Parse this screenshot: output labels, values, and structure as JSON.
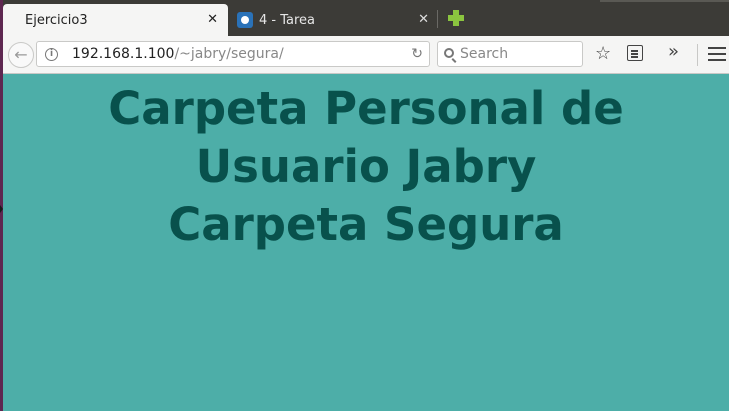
{
  "browser": {
    "tabs": [
      {
        "title": "Ejercicio3",
        "active": true
      },
      {
        "title": "4 - Tarea",
        "active": false
      }
    ],
    "tab_close_glyph": "✕",
    "url": {
      "host": "192.168.1.100",
      "path": "/~jabry/segura/"
    },
    "search": {
      "placeholder": "Search",
      "value": ""
    },
    "icons": [
      "back-icon",
      "info-icon",
      "reload-icon",
      "search-icon",
      "bookmark-star-icon",
      "reader-view-icon",
      "overflow-chevron-icon",
      "hamburger-menu-icon",
      "new-tab-plus-icon"
    ]
  },
  "page": {
    "heading_lines": [
      "Carpeta Personal de",
      "Usuario Jabry",
      "Carpeta Segura"
    ],
    "colors": {
      "background": "#4daea8",
      "heading": "#08514c"
    }
  }
}
